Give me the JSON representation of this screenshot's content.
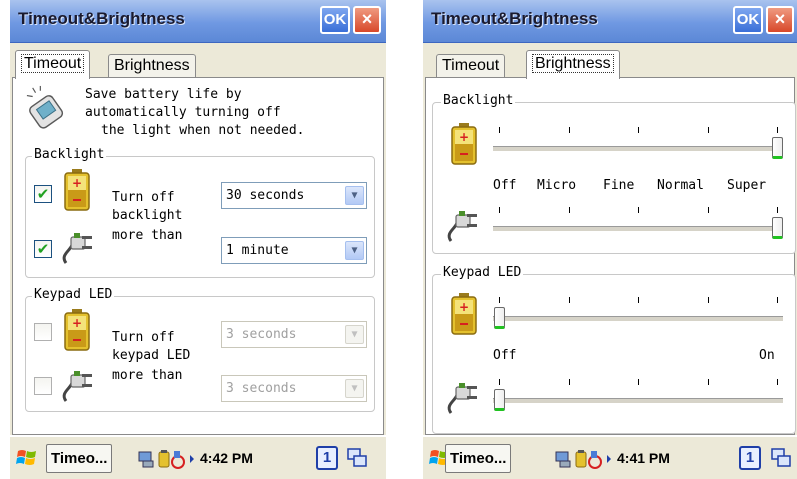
{
  "left_window": {
    "title": "Timeout&Brightness",
    "ok_label": "OK",
    "close_label": "×",
    "tabs": [
      {
        "label": "Timeout",
        "active": true
      },
      {
        "label": "Brightness",
        "active": false
      }
    ],
    "intro_lines": [
      "Save battery life by",
      "automatically turning off",
      "the light when not needed."
    ],
    "backlight": {
      "title": "Backlight",
      "battery_checked": true,
      "ac_checked": true,
      "label_lines": [
        "Turn off",
        "backlight",
        "more than"
      ],
      "battery_select": "30 seconds",
      "ac_select": "1 minute"
    },
    "keypad": {
      "title": "Keypad LED",
      "battery_checked": false,
      "ac_checked": false,
      "label_lines": [
        "Turn off",
        "keypad LED",
        "more than"
      ],
      "battery_select": "3 seconds",
      "ac_select": "3 seconds"
    },
    "taskbar": {
      "task": "Timeo...",
      "clock": "4:42 PM",
      "input": "1"
    }
  },
  "right_window": {
    "title": "Timeout&Brightness",
    "ok_label": "OK",
    "close_label": "×",
    "tabs": [
      {
        "label": "Timeout",
        "active": false
      },
      {
        "label": "Brightness",
        "active": true
      }
    ],
    "backlight": {
      "title": "Backlight",
      "levels": [
        "Off",
        "Micro",
        "Fine",
        "Normal",
        "Super"
      ],
      "battery_level": "Super",
      "ac_level": "Super"
    },
    "keypad": {
      "title": "Keypad LED",
      "label_off": "Off",
      "label_on": "On",
      "battery_level": "Off",
      "ac_level": "Off"
    },
    "taskbar": {
      "task": "Timeo...",
      "clock": "4:41 PM",
      "input": "1"
    }
  },
  "icons": {
    "battery": "battery-icon",
    "ac_power": "plug-icon",
    "battery_tip": "lightbulb-device-icon",
    "start": "windows-flag-icon",
    "switch": "windows-switch-icon"
  },
  "colors": {
    "title_bar": "#6f98e2",
    "ok": "#3a6fd8",
    "close": "#d8482a",
    "check": "#21a121",
    "thumb_accent": "#21c221"
  }
}
